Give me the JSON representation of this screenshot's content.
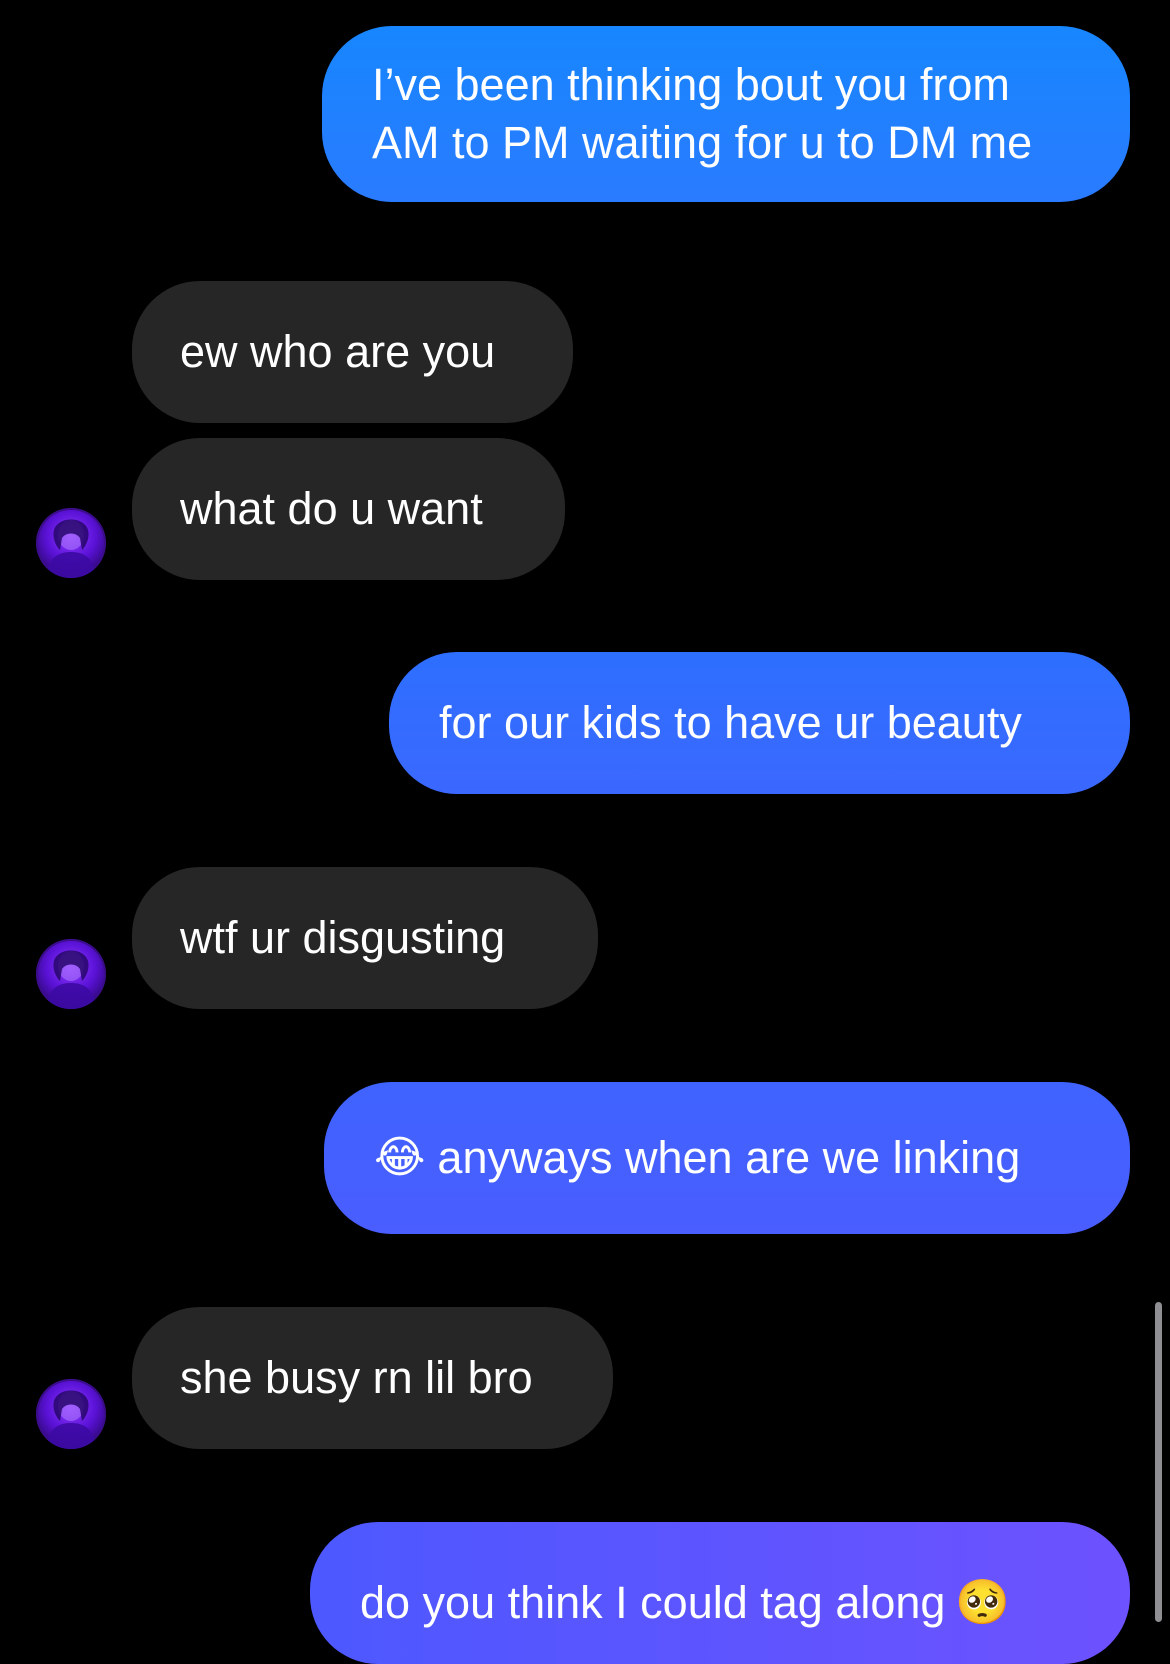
{
  "thread": {
    "messages": [
      {
        "id": "m1",
        "side": "sent",
        "lines": [
          "I’ve been thinking bout you from",
          "AM to PM waiting for u to DM me"
        ]
      },
      {
        "id": "m2",
        "side": "received",
        "text": "ew who are you"
      },
      {
        "id": "m3",
        "side": "received",
        "text": "what do u want"
      },
      {
        "id": "m4",
        "side": "sent",
        "text": "for our kids to have ur beauty"
      },
      {
        "id": "m5",
        "side": "received",
        "text": "wtf ur disgusting"
      },
      {
        "id": "m6",
        "side": "sent",
        "emoji": "😂",
        "text": "anyways when are we linking"
      },
      {
        "id": "m7",
        "side": "received",
        "text": "she busy rn lil bro"
      },
      {
        "id": "m8",
        "side": "sent",
        "text": "do you think I could tag along",
        "emoji": "🥺"
      }
    ]
  },
  "colors": {
    "background": "#000000",
    "received_bubble": "#262626",
    "sent_gradient_top": "#1b87ff",
    "sent_gradient_bottom": "#6a52ff",
    "text": "#ffffff"
  },
  "icons": {
    "avatar": "contact-avatar-purple"
  }
}
